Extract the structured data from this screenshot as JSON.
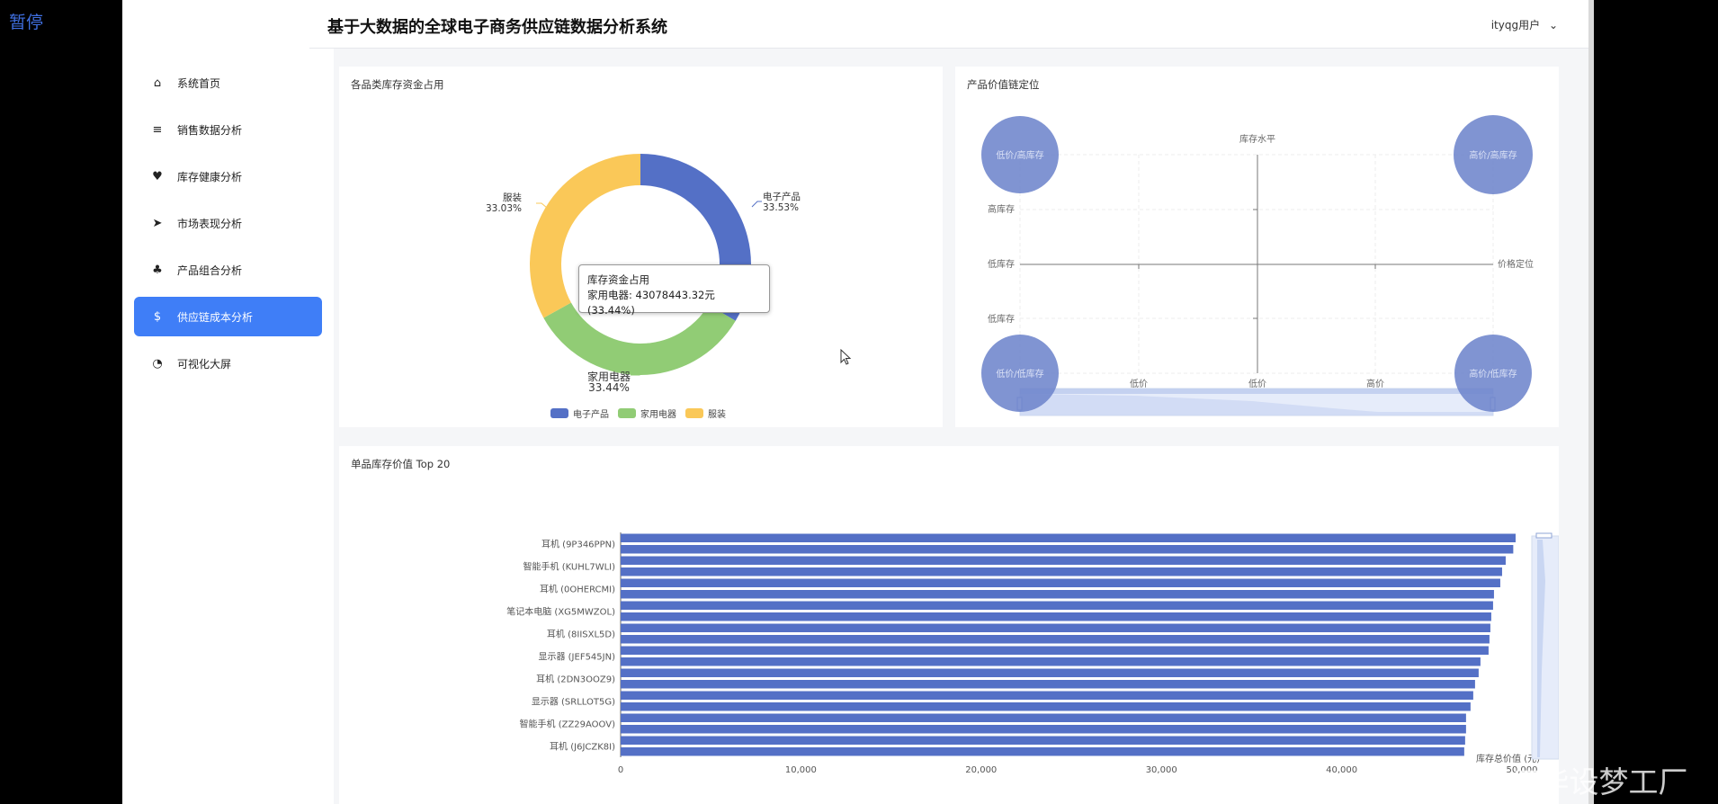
{
  "overlay": {
    "pause_label": "暂停",
    "watermark": "CSDN @IT毕设梦工厂"
  },
  "header": {
    "title": "基于大数据的全球电子商务供应链数据分析系统",
    "user": "ityqg用户"
  },
  "sidebar": {
    "items": [
      {
        "label": "系统首页",
        "icon": "home-icon",
        "active": false
      },
      {
        "label": "销售数据分析",
        "icon": "bar-chart-icon",
        "active": false
      },
      {
        "label": "库存健康分析",
        "icon": "heartbeat-icon",
        "active": false
      },
      {
        "label": "市场表现分析",
        "icon": "rocket-icon",
        "active": false
      },
      {
        "label": "产品组合分析",
        "icon": "cubes-icon",
        "active": false
      },
      {
        "label": "供应链成本分析",
        "icon": "dollar-icon",
        "active": true
      },
      {
        "label": "可视化大屏",
        "icon": "dashboard-icon",
        "active": false
      }
    ]
  },
  "donut_card": {
    "title": "各品类库存资金占用",
    "tooltip": {
      "title": "库存资金占用",
      "line": "家用电器: 43078443.32元 (33.44%)"
    }
  },
  "matrix_card": {
    "title": "产品价值链定位",
    "y_axis_name": "库存水平",
    "x_axis_name": "价格定位",
    "y_ticks": [
      "高库存",
      "低库存",
      "低库存"
    ],
    "x_ticks": [
      "低价",
      "低价",
      "高价"
    ],
    "quadrants": [
      "低价/高库存",
      "高价/高库存",
      "低价/低库存",
      "高价/低库存"
    ]
  },
  "bar_card": {
    "title": "单品库存价值 Top 20"
  },
  "colors": {
    "accent": "#3f7ef7",
    "series1": "#5470c6",
    "series2": "#91cc75",
    "series3": "#fac858"
  },
  "chart_data": [
    {
      "type": "pie",
      "title": "",
      "categories": [
        "电子产品",
        "家用电器",
        "服装"
      ],
      "values": [
        33.53,
        33.44,
        33.03
      ],
      "value_labels": [
        "33.53%",
        "33.44%",
        "33.03%"
      ],
      "legend_position": "bottom",
      "colors": [
        "#5470c6",
        "#91cc75",
        "#fac858"
      ]
    },
    {
      "type": "bar",
      "orientation": "horizontal",
      "title": "",
      "xlabel": "库存总价值 (元)",
      "ylabel": "",
      "xlim": [
        0,
        50000
      ],
      "x_ticks": [
        "0",
        "10,000",
        "20,000",
        "30,000",
        "40,000",
        "50,000"
      ],
      "categories": [
        "耳机 (9P346PPN)",
        "",
        "智能手机 (KUHL7WLI)",
        "",
        "耳机 (0OHERCMI)",
        "",
        "笔记本电脑 (XG5MWZOL)",
        "",
        "耳机 (8IISXL5D)",
        "",
        "显示器 (JEF545JN)",
        "",
        "耳机 (2DN3OOZ9)",
        "",
        "显示器 (SRLLOT5G)",
        "",
        "智能手机 (ZZ29AOOV)",
        "",
        "耳机 (J6JCZK8I)",
        ""
      ],
      "values": [
        49650,
        49520,
        49100,
        48900,
        48800,
        48450,
        48400,
        48300,
        48250,
        48200,
        48150,
        47700,
        47600,
        47400,
        47300,
        47150,
        46900,
        46900,
        46850,
        46800
      ],
      "grid": false,
      "color": "#5470c6"
    }
  ]
}
